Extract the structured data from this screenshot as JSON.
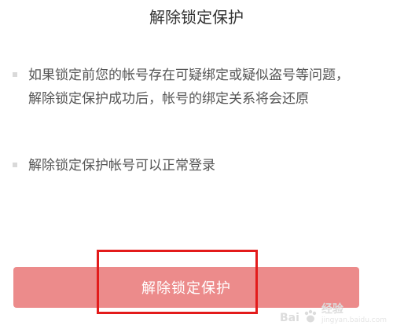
{
  "page": {
    "title": "解除锁定保护"
  },
  "notices": [
    "如果锁定前您的帐号存在可疑绑定或疑似盗号等问题，解除锁定保护成功后，帐号的绑定关系将会还原",
    "解除锁定保护帐号可以正常登录"
  ],
  "button": {
    "label": "解除锁定保护"
  },
  "watermark": {
    "brand": "Bai",
    "brand_suffix": "经验",
    "url": "jingyan.baidu.com"
  },
  "colors": {
    "button_bg": "#ec8b8b",
    "highlight": "#e31b1b",
    "bullet": "#d9d9d9"
  }
}
